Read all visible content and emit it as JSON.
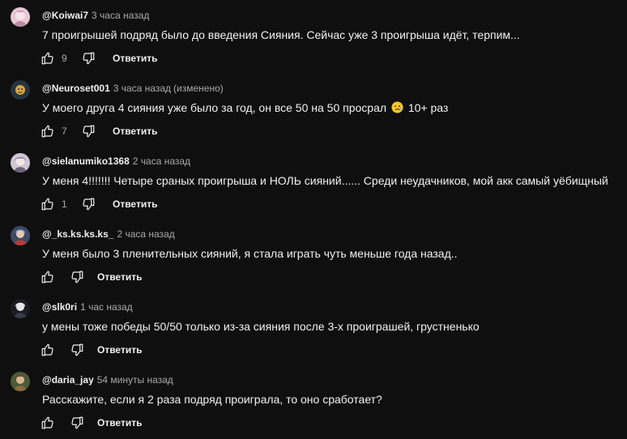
{
  "colors": {
    "background": "#0f0f0f",
    "text": "#f1f1f1",
    "secondary": "#aaaaaa"
  },
  "actions": {
    "reply_label": "Ответить"
  },
  "comments": [
    {
      "author": "@Koiwai7",
      "time": "3 часа назад",
      "edited": "",
      "text": "7 проигрышей подряд было до введения Сияния. Сейчас уже 3 проигрыша идёт, терпим...",
      "text_after_emoji": "",
      "likes": "9",
      "avatar": "anime-avatar"
    },
    {
      "author": "@Neuroset001",
      "time": "3 часа назад",
      "edited": "(изменено)",
      "text": "У моего друга 4 сияния уже было за год, он все 50 на 50 просрал",
      "emoji": "sad-face-emoji",
      "text_after_emoji": "10+ раз",
      "likes": "7",
      "avatar": "dark-avatar"
    },
    {
      "author": "@sielanumiko1368",
      "time": "2 часа назад",
      "edited": "",
      "text": "У меня 4!!!!!!! Четыре сраных проигрыша и НОЛЬ сияний...... Среди неудачников, мой акк самый уёбищный",
      "text_after_emoji": "",
      "likes": "1",
      "avatar": "anime-avatar"
    },
    {
      "author": "@_ks.ks.ks.ks_",
      "time": "2 часа назад",
      "edited": "",
      "text": "У меня было 3 пленительных сияний, я стала играть чуть меньше года назад..",
      "text_after_emoji": "",
      "likes": "",
      "avatar": "character-avatar"
    },
    {
      "author": "@slk0ri",
      "time": "1 час назад",
      "edited": "",
      "text": "у мены тоже победы 50/50 только из-за сияния после 3-х проиграшей, грустненько",
      "text_after_emoji": "",
      "likes": "",
      "avatar": "character-avatar"
    },
    {
      "author": "@daria_jay",
      "time": "54 минуты назад",
      "edited": "",
      "text": "Расскажите, если я 2 раза подряд проиграла, то оно сработает?",
      "text_after_emoji": "",
      "likes": "",
      "avatar": "character-avatar"
    }
  ]
}
